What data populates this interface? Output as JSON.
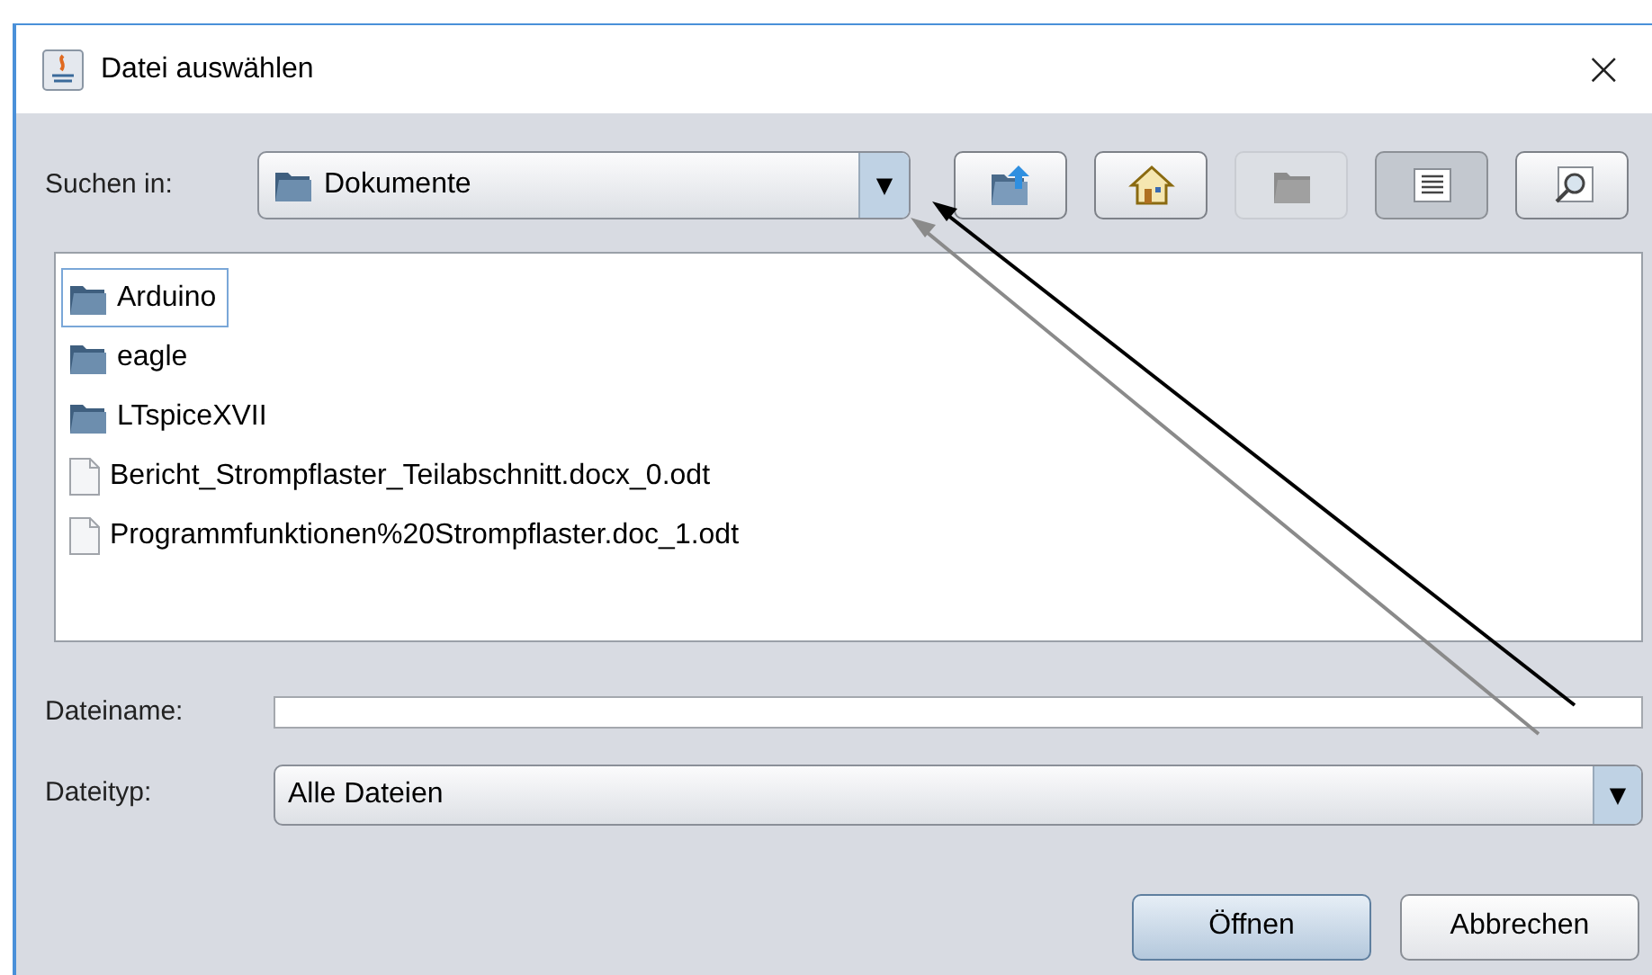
{
  "window": {
    "title": "Datei auswählen",
    "close": "×"
  },
  "look_in": {
    "label": "Suchen in:",
    "value": "Dokumente",
    "arrow": "▼"
  },
  "toolbar": [
    {
      "kind": "up",
      "disabled": false,
      "selected": false
    },
    {
      "kind": "home",
      "disabled": false,
      "selected": false
    },
    {
      "kind": "new-folder",
      "disabled": true,
      "selected": false
    },
    {
      "kind": "list",
      "disabled": false,
      "selected": true
    },
    {
      "kind": "details",
      "disabled": false,
      "selected": false
    }
  ],
  "files": [
    {
      "kind": "folder",
      "name": "Arduino",
      "selected": true
    },
    {
      "kind": "folder",
      "name": "eagle",
      "selected": false
    },
    {
      "kind": "folder",
      "name": "LTspiceXVII",
      "selected": false
    },
    {
      "kind": "file",
      "name": "Bericht_Strompflaster_Teilabschnitt.docx_0.odt",
      "selected": false
    },
    {
      "kind": "file",
      "name": "Programmfunktionen%20Strompflaster.doc_1.odt",
      "selected": false
    }
  ],
  "file_name": {
    "label": "Dateiname:"
  },
  "file_type": {
    "label": "Dateityp:",
    "value": "Alle Dateien",
    "arrow": "▼"
  },
  "buttons": [
    {
      "label": "Öffnen",
      "default": true
    },
    {
      "label": "Abbrechen",
      "default": false
    }
  ]
}
